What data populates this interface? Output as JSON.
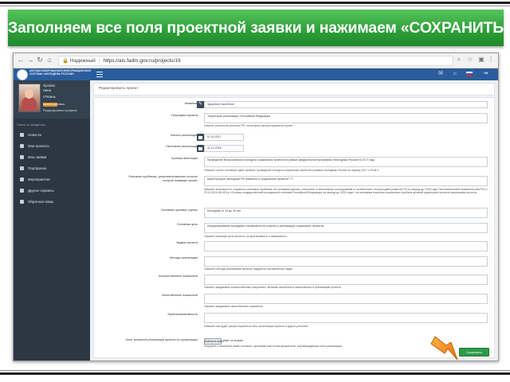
{
  "headline": "Заполняем все поля проектной заявки и нажимаем «СОХРАНИТЬ»",
  "browser": {
    "secure_label": "Надежный",
    "url": "https://ais.fadm.gov.ru/projects/19"
  },
  "app": {
    "logo_text": "АВТОМАТИЗИРОВАННАЯ ИНФОРМАЦИОННАЯ СИСТЕМА «МОЛОДЕЖЬ РОССИИ»"
  },
  "profile": {
    "last_name": "Орлова",
    "first_name": "Нина",
    "location": "г.Рязань",
    "badge": "ВЕРИФИЦИРОВАН",
    "edit_profile": "Редактировать профиль"
  },
  "sidebar": {
    "section_title": "Поиск по разделам",
    "items": [
      {
        "label": "Новости"
      },
      {
        "label": "Мои проекты"
      },
      {
        "label": "Мои заявки"
      },
      {
        "label": "Портфолио"
      },
      {
        "label": "Мероприятия"
      },
      {
        "label": "Другие сервисы"
      },
      {
        "label": "Обратная связь"
      }
    ]
  },
  "page": {
    "title": "Редактировать проект"
  },
  "form": {
    "fields": [
      {
        "label": "Название",
        "value": "Здоровое поколение"
      },
      {
        "label": "География проекта",
        "value": "Территория реализации: Российская Федерация",
        "hint": "Укажите регион или регионы РФ, на которые распространяется проект"
      },
      {
        "label": "Начало реализации",
        "value": "01.02.2017"
      },
      {
        "label": "Окончание реализации",
        "value": "31.12.2018"
      },
      {
        "label": "Краткая аннотация",
        "value": "Проведение Всероссийского конкурса социальных проектов в рамках федеральной программы «Молодежь России» в 2017 году",
        "hint": "Опишите кратко основную идею проекта: проведение конкурса социальных проектов в рамках Молодежь России на период 2017 и 2018 гг."
      },
      {
        "label": "Описание проблемы, решению/снижению остроты которой посвящен проект",
        "value": "Какой процент молодежи РФ вовлечен в социальные проекты? ??",
        "hint": "Укажите актуальность социально-значимой проблемы на основании данных статистики и объективных исследований в соответствии с Концепцией развития РФ на период до 2025 года, Постановлением Правительства РФ от 29.11.2014 №2403-р «Основы государственной молодежной политики Российской Федерации на период до 2025 года», на основании изучения социальных проблем целевой аудитории в регионе реализации проекта."
      },
      {
        "label": "Основные целевые группы",
        "value": "Молодежь от 14 до 30 лет"
      },
      {
        "label": "Основная цель",
        "value": "Информирование молодежи о возможностях участия в реализации социальных проектов",
        "hint": "Укажите основную цель проекта, ее достижимость и измеримость"
      },
      {
        "label": "Задачи проекта",
        "value": ""
      },
      {
        "label": "Методы реализации",
        "value": "",
        "hint": "Опишите методы реализации проекта, каждой из поставленных задач"
      },
      {
        "label": "Количественные показатели",
        "value": "",
        "hint": "Укажите ожидаемые количественные результаты, включая численность вовлеченных в реализацию проекта"
      },
      {
        "label": "Качественные показатели",
        "value": "",
        "hint": "Укажите ожидаемые качественные показатели"
      },
      {
        "label": "Мультипликативность",
        "value": "",
        "hint": "Опишите как будет распространяться опыт реализации проекта в других регионах"
      },
      {
        "label": "Опыт успешной реализации проекта по организации",
        "value": "",
        "hint": "Загрузите и заполните файл согласия, приложив скан-копии документов, подтверждающих опыт реализации"
      }
    ],
    "file_button": "Выберите файл",
    "file_none": "Файл не выбран",
    "save_button": "Сохранить"
  },
  "colors": {
    "banner_green": "#2fa13a",
    "app_blue": "#2b5d9c",
    "sidebar_dark": "#2c3744",
    "save_green": "#2e9a4a",
    "arrow_orange": "#f08a12"
  }
}
